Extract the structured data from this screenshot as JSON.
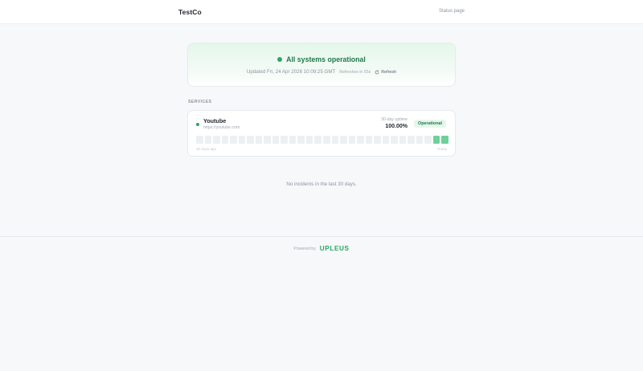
{
  "header": {
    "brand": "TestCo",
    "status_link": "Status page"
  },
  "hero": {
    "title": "All systems operational",
    "updated": "Updated Fri, 24 Apr 2026 10:09:25 GMT",
    "refreshes": "Refreshes in 55s",
    "refresh_label": "Refresh",
    "status_color": "#2ea664"
  },
  "services_section": {
    "label": "SERVICES",
    "items": [
      {
        "name": "Youtube",
        "url": "https://youtube.com",
        "uptime_label": "30-day uptime",
        "uptime_value": "100.00%",
        "badge": "Operational",
        "bars": [
          "none",
          "none",
          "none",
          "none",
          "none",
          "none",
          "none",
          "none",
          "none",
          "none",
          "none",
          "none",
          "none",
          "none",
          "none",
          "none",
          "none",
          "none",
          "none",
          "none",
          "none",
          "none",
          "none",
          "none",
          "none",
          "none",
          "none",
          "none",
          "up",
          "up"
        ],
        "caption_left": "30 days ago",
        "caption_right": "Today"
      }
    ]
  },
  "incidents": {
    "empty_text": "No incidents in the last 30 days."
  },
  "footer": {
    "powered_by": "Powered by",
    "logo_text": "UPLEUS"
  },
  "colors": {
    "accent": "#2ea664",
    "bar_up": "#6fd09a",
    "bar_empty": "#edf0f3"
  }
}
